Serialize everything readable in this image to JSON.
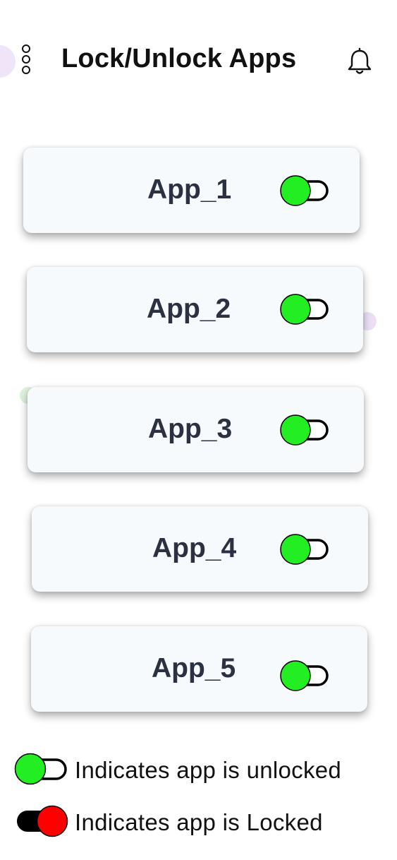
{
  "header": {
    "title": "Lock/Unlock Apps",
    "menu_icon": "kebab-menu-icon",
    "notification_icon": "bell-icon"
  },
  "apps": [
    {
      "name": "App_1",
      "state": "unlocked"
    },
    {
      "name": "App_2",
      "state": "unlocked"
    },
    {
      "name": "App_3",
      "state": "unlocked"
    },
    {
      "name": "App_4",
      "state": "unlocked"
    },
    {
      "name": "App_5",
      "state": "unlocked"
    }
  ],
  "legend": {
    "unlocked_text": "Indicates app is unlocked",
    "locked_text": "Indicates app is Locked"
  },
  "colors": {
    "unlocked": "#22ee22",
    "locked": "#ff0000",
    "card_background": "#f7fafd",
    "card_text": "#2b3140"
  }
}
